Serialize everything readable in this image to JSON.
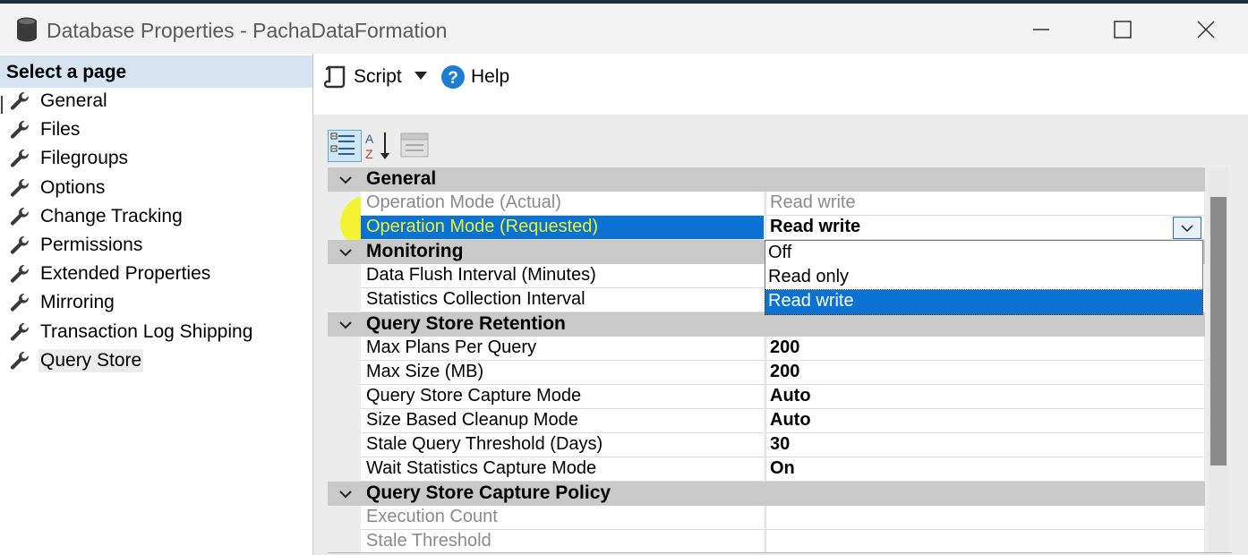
{
  "window": {
    "title": "Database Properties - PachaDataFormation",
    "icons": {
      "app": "database-icon",
      "minimize": "minimize-icon",
      "maximize": "maximize-icon",
      "close": "close-icon"
    }
  },
  "left_pane": {
    "header": "Select a page",
    "items": [
      {
        "label": "General"
      },
      {
        "label": "Files"
      },
      {
        "label": "Filegroups"
      },
      {
        "label": "Options"
      },
      {
        "label": "Change Tracking"
      },
      {
        "label": "Permissions"
      },
      {
        "label": "Extended Properties"
      },
      {
        "label": "Mirroring"
      },
      {
        "label": "Transaction Log Shipping"
      },
      {
        "label": "Query Store",
        "selected": true
      }
    ]
  },
  "toolbar": {
    "script_label": "Script",
    "help_label": "Help"
  },
  "property_grid": {
    "rows": [
      {
        "type": "category",
        "label": "General"
      },
      {
        "type": "property",
        "name": "Operation Mode (Actual)",
        "value": "Read write",
        "dim": true
      },
      {
        "type": "property",
        "name": "Operation Mode (Requested)",
        "value": "Read write",
        "selected": true
      },
      {
        "type": "category",
        "label": "Monitoring"
      },
      {
        "type": "property",
        "name": "Data Flush Interval (Minutes)",
        "value": ""
      },
      {
        "type": "property",
        "name": "Statistics Collection Interval",
        "value": ""
      },
      {
        "type": "category",
        "label": "Query Store Retention"
      },
      {
        "type": "property",
        "name": "Max Plans Per Query",
        "value": "200"
      },
      {
        "type": "property",
        "name": "Max Size (MB)",
        "value": "200"
      },
      {
        "type": "property",
        "name": "Query Store Capture Mode",
        "value": "Auto"
      },
      {
        "type": "property",
        "name": "Size Based Cleanup Mode",
        "value": "Auto"
      },
      {
        "type": "property",
        "name": "Stale Query Threshold (Days)",
        "value": "30"
      },
      {
        "type": "property",
        "name": "Wait Statistics Capture Mode",
        "value": "On"
      },
      {
        "type": "category",
        "label": "Query Store Capture Policy"
      },
      {
        "type": "property",
        "name": "Execution Count",
        "value": "",
        "dim": true
      },
      {
        "type": "property",
        "name": "Stale Threshold",
        "value": "",
        "dim": true
      }
    ],
    "dropdown": {
      "options": [
        "Off",
        "Read only",
        "Read write"
      ],
      "selected": "Read write"
    }
  },
  "colors": {
    "selection": "#0a72d2",
    "highlight": "#f4f414",
    "category_bg": "#c9c9c9",
    "left_header_bg": "#d6e4f2"
  }
}
